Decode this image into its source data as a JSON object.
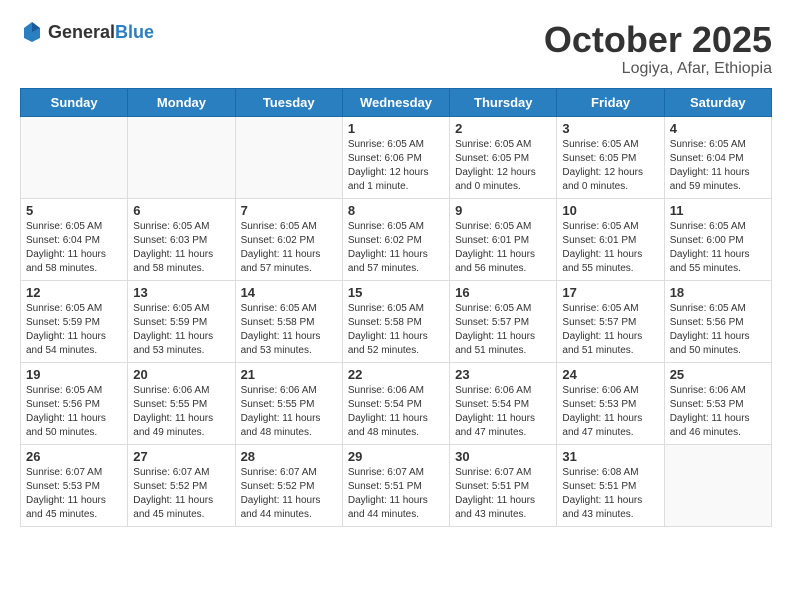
{
  "header": {
    "logo_general": "General",
    "logo_blue": "Blue",
    "month": "October 2025",
    "location": "Logiya, Afar, Ethiopia"
  },
  "weekdays": [
    "Sunday",
    "Monday",
    "Tuesday",
    "Wednesday",
    "Thursday",
    "Friday",
    "Saturday"
  ],
  "weeks": [
    [
      {
        "day": "",
        "info": ""
      },
      {
        "day": "",
        "info": ""
      },
      {
        "day": "",
        "info": ""
      },
      {
        "day": "1",
        "info": "Sunrise: 6:05 AM\nSunset: 6:06 PM\nDaylight: 12 hours\nand 1 minute."
      },
      {
        "day": "2",
        "info": "Sunrise: 6:05 AM\nSunset: 6:05 PM\nDaylight: 12 hours\nand 0 minutes."
      },
      {
        "day": "3",
        "info": "Sunrise: 6:05 AM\nSunset: 6:05 PM\nDaylight: 12 hours\nand 0 minutes."
      },
      {
        "day": "4",
        "info": "Sunrise: 6:05 AM\nSunset: 6:04 PM\nDaylight: 11 hours\nand 59 minutes."
      }
    ],
    [
      {
        "day": "5",
        "info": "Sunrise: 6:05 AM\nSunset: 6:04 PM\nDaylight: 11 hours\nand 58 minutes."
      },
      {
        "day": "6",
        "info": "Sunrise: 6:05 AM\nSunset: 6:03 PM\nDaylight: 11 hours\nand 58 minutes."
      },
      {
        "day": "7",
        "info": "Sunrise: 6:05 AM\nSunset: 6:02 PM\nDaylight: 11 hours\nand 57 minutes."
      },
      {
        "day": "8",
        "info": "Sunrise: 6:05 AM\nSunset: 6:02 PM\nDaylight: 11 hours\nand 57 minutes."
      },
      {
        "day": "9",
        "info": "Sunrise: 6:05 AM\nSunset: 6:01 PM\nDaylight: 11 hours\nand 56 minutes."
      },
      {
        "day": "10",
        "info": "Sunrise: 6:05 AM\nSunset: 6:01 PM\nDaylight: 11 hours\nand 55 minutes."
      },
      {
        "day": "11",
        "info": "Sunrise: 6:05 AM\nSunset: 6:00 PM\nDaylight: 11 hours\nand 55 minutes."
      }
    ],
    [
      {
        "day": "12",
        "info": "Sunrise: 6:05 AM\nSunset: 5:59 PM\nDaylight: 11 hours\nand 54 minutes."
      },
      {
        "day": "13",
        "info": "Sunrise: 6:05 AM\nSunset: 5:59 PM\nDaylight: 11 hours\nand 53 minutes."
      },
      {
        "day": "14",
        "info": "Sunrise: 6:05 AM\nSunset: 5:58 PM\nDaylight: 11 hours\nand 53 minutes."
      },
      {
        "day": "15",
        "info": "Sunrise: 6:05 AM\nSunset: 5:58 PM\nDaylight: 11 hours\nand 52 minutes."
      },
      {
        "day": "16",
        "info": "Sunrise: 6:05 AM\nSunset: 5:57 PM\nDaylight: 11 hours\nand 51 minutes."
      },
      {
        "day": "17",
        "info": "Sunrise: 6:05 AM\nSunset: 5:57 PM\nDaylight: 11 hours\nand 51 minutes."
      },
      {
        "day": "18",
        "info": "Sunrise: 6:05 AM\nSunset: 5:56 PM\nDaylight: 11 hours\nand 50 minutes."
      }
    ],
    [
      {
        "day": "19",
        "info": "Sunrise: 6:05 AM\nSunset: 5:56 PM\nDaylight: 11 hours\nand 50 minutes."
      },
      {
        "day": "20",
        "info": "Sunrise: 6:06 AM\nSunset: 5:55 PM\nDaylight: 11 hours\nand 49 minutes."
      },
      {
        "day": "21",
        "info": "Sunrise: 6:06 AM\nSunset: 5:55 PM\nDaylight: 11 hours\nand 48 minutes."
      },
      {
        "day": "22",
        "info": "Sunrise: 6:06 AM\nSunset: 5:54 PM\nDaylight: 11 hours\nand 48 minutes."
      },
      {
        "day": "23",
        "info": "Sunrise: 6:06 AM\nSunset: 5:54 PM\nDaylight: 11 hours\nand 47 minutes."
      },
      {
        "day": "24",
        "info": "Sunrise: 6:06 AM\nSunset: 5:53 PM\nDaylight: 11 hours\nand 47 minutes."
      },
      {
        "day": "25",
        "info": "Sunrise: 6:06 AM\nSunset: 5:53 PM\nDaylight: 11 hours\nand 46 minutes."
      }
    ],
    [
      {
        "day": "26",
        "info": "Sunrise: 6:07 AM\nSunset: 5:53 PM\nDaylight: 11 hours\nand 45 minutes."
      },
      {
        "day": "27",
        "info": "Sunrise: 6:07 AM\nSunset: 5:52 PM\nDaylight: 11 hours\nand 45 minutes."
      },
      {
        "day": "28",
        "info": "Sunrise: 6:07 AM\nSunset: 5:52 PM\nDaylight: 11 hours\nand 44 minutes."
      },
      {
        "day": "29",
        "info": "Sunrise: 6:07 AM\nSunset: 5:51 PM\nDaylight: 11 hours\nand 44 minutes."
      },
      {
        "day": "30",
        "info": "Sunrise: 6:07 AM\nSunset: 5:51 PM\nDaylight: 11 hours\nand 43 minutes."
      },
      {
        "day": "31",
        "info": "Sunrise: 6:08 AM\nSunset: 5:51 PM\nDaylight: 11 hours\nand 43 minutes."
      },
      {
        "day": "",
        "info": ""
      }
    ]
  ]
}
